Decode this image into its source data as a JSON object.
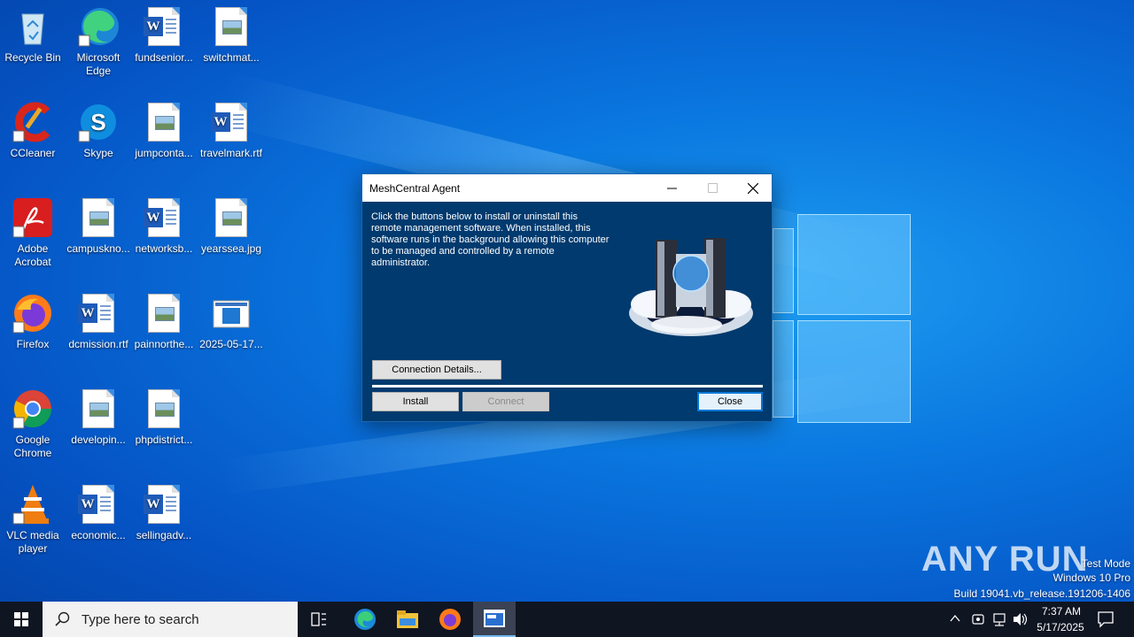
{
  "desktop": {
    "icons": [
      {
        "label": "Recycle Bin",
        "icon": "recycle-bin-icon"
      },
      {
        "label": "Microsoft Edge",
        "icon": "edge-icon"
      },
      {
        "label": "fundsenior...",
        "icon": "word-document-icon"
      },
      {
        "label": "switchmat...",
        "icon": "image-file-icon"
      },
      {
        "label": "CCleaner",
        "icon": "ccleaner-icon"
      },
      {
        "label": "Skype",
        "icon": "skype-icon"
      },
      {
        "label": "jumpconta...",
        "icon": "image-file-icon"
      },
      {
        "label": "travelmark.rtf",
        "icon": "word-document-icon"
      },
      {
        "label": "Adobe Acrobat",
        "icon": "acrobat-icon"
      },
      {
        "label": "campuskno...",
        "icon": "image-file-icon"
      },
      {
        "label": "networksb...",
        "icon": "word-document-icon"
      },
      {
        "label": "yearssea.jpg",
        "icon": "image-file-icon"
      },
      {
        "label": "Firefox",
        "icon": "firefox-icon"
      },
      {
        "label": "dcmission.rtf",
        "icon": "word-document-icon"
      },
      {
        "label": "painnorthe...",
        "icon": "image-file-icon"
      },
      {
        "label": "2025-05-17...",
        "icon": "screenshot-file-icon"
      },
      {
        "label": "Google Chrome",
        "icon": "chrome-icon"
      },
      {
        "label": "developin...",
        "icon": "image-file-icon"
      },
      {
        "label": "phpdistrict...",
        "icon": "image-file-icon"
      },
      {
        "label": "VLC media player",
        "icon": "vlc-icon"
      },
      {
        "label": "economic...",
        "icon": "word-document-icon"
      },
      {
        "label": "sellingadv...",
        "icon": "word-document-icon"
      }
    ]
  },
  "dialog": {
    "title": "MeshCentral Agent",
    "description": "Click the buttons below to install or uninstall this remote management software. When installed, this software runs in the background allowing this computer to be managed and controlled by a remote administrator.",
    "connection_details_label": "Connection Details...",
    "install_label": "Install",
    "connect_label": "Connect",
    "close_label": "Close"
  },
  "taskbar": {
    "search_placeholder": "Type here to search",
    "time": "7:37 AM",
    "date": "5/17/2025"
  },
  "watermark": {
    "brand": "ANY RUN",
    "line1": "Test Mode",
    "line2": "Windows 10 Pro",
    "line3": "Build 19041.vb_release.191206-1406"
  },
  "colors": {
    "desktop_blue": "#0a78e0",
    "dialog_bg": "#003a6e",
    "taskbar_bg": "#101522",
    "accent": "#0078d7"
  }
}
